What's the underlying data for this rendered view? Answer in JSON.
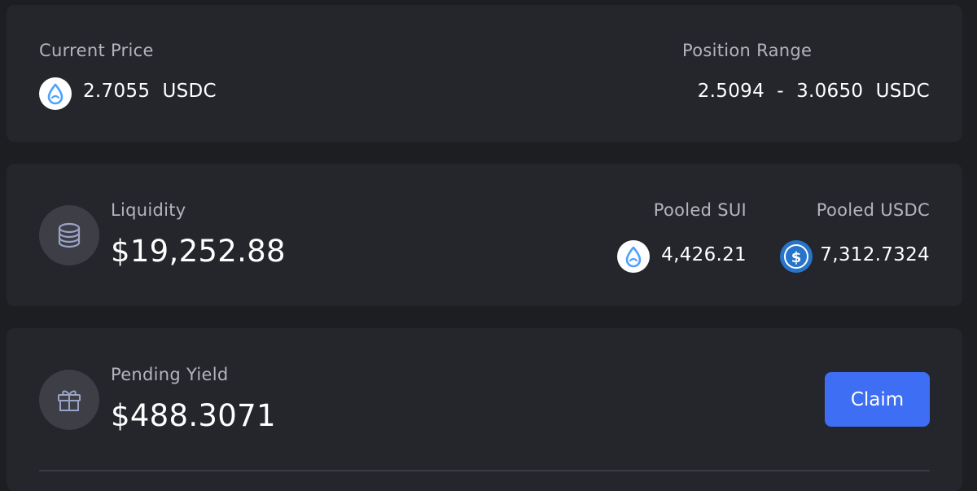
{
  "price_card": {
    "current_price_label": "Current Price",
    "current_price_value": "2.7055",
    "current_price_unit": "USDC",
    "position_range_label": "Position Range",
    "range_min": "2.5094",
    "range_separator": "-",
    "range_max": "3.0650",
    "range_unit": "USDC"
  },
  "liquidity_card": {
    "label": "Liquidity",
    "value": "$19,252.88",
    "pooled_sui_label": "Pooled SUI",
    "pooled_sui_value": "4,426.21",
    "pooled_usdc_label": "Pooled USDC",
    "pooled_usdc_value": "7,312.7324"
  },
  "yield_card": {
    "label": "Pending Yield",
    "value": "$488.3071",
    "claim_label": "Claim"
  },
  "colors": {
    "background": "#1d1e22",
    "card": "#25262c",
    "accent": "#3e6ef4",
    "sui_blue": "#4da2ff",
    "usdc_blue": "#2775ca"
  },
  "icons": {
    "sui": "sui-drop-icon",
    "usdc": "usdc-dollar-icon",
    "liquidity": "coin-stack-icon",
    "yield": "gift-icon"
  }
}
